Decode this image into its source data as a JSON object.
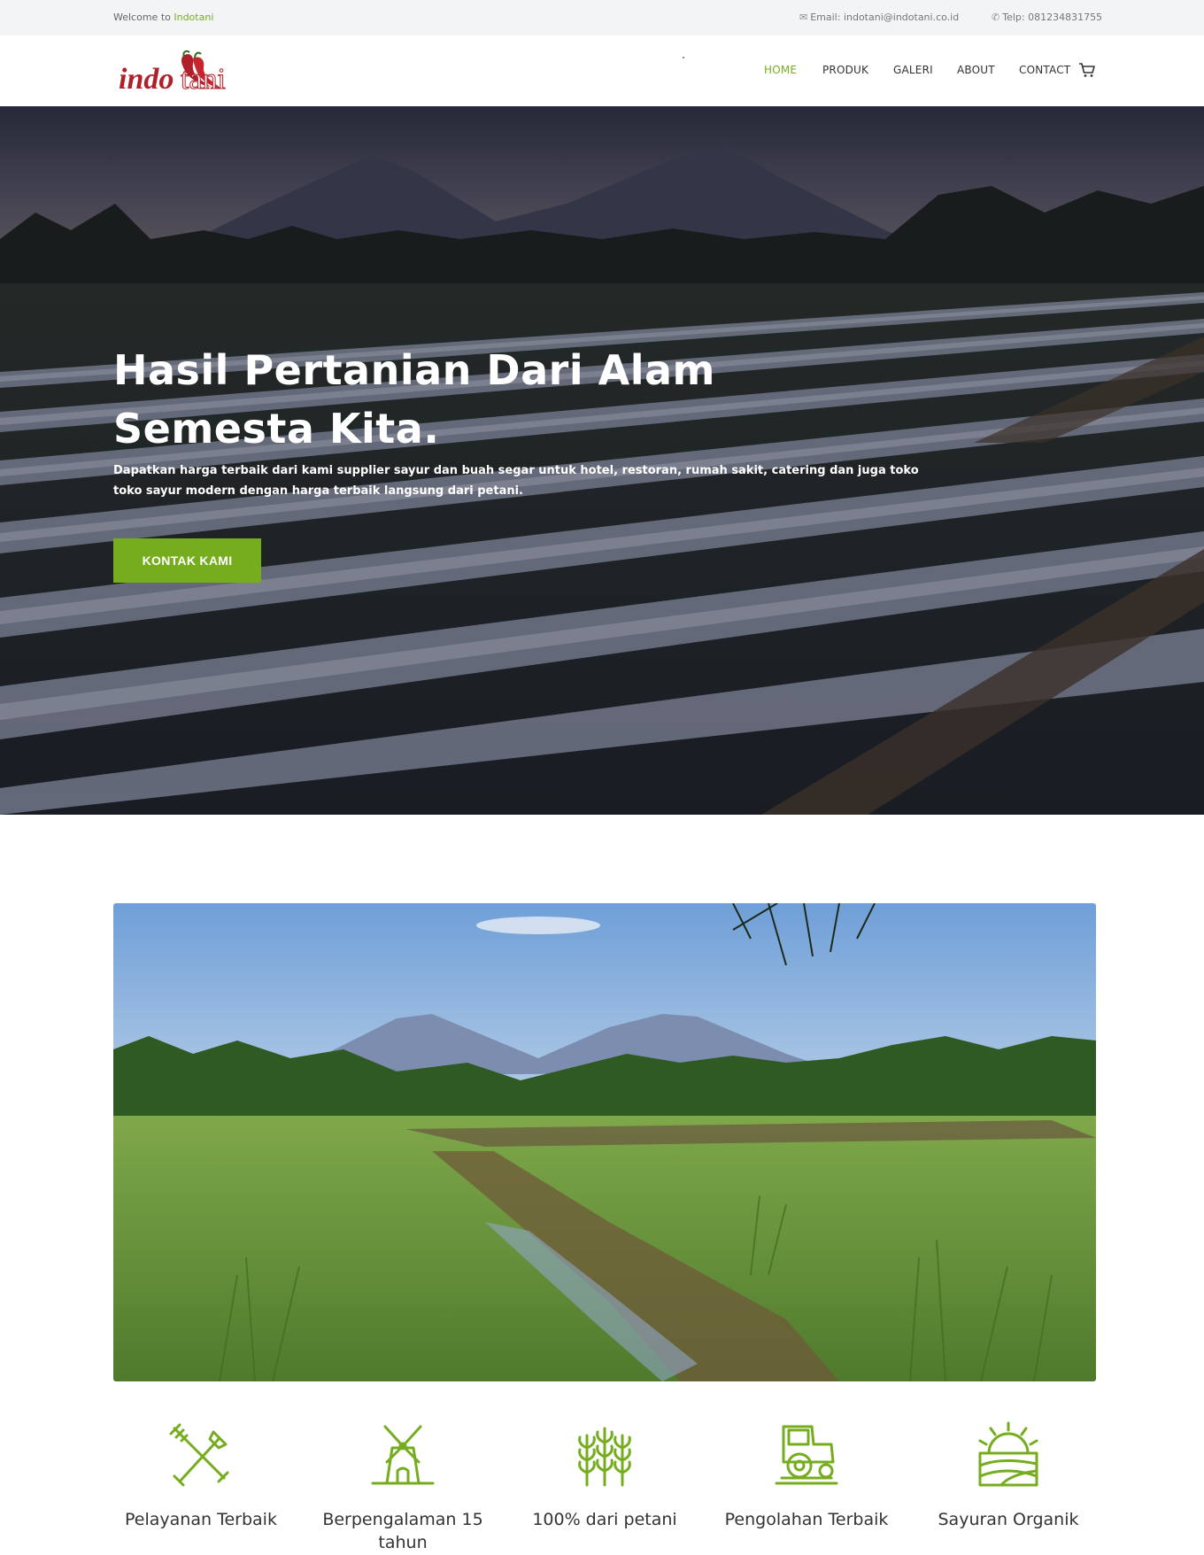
{
  "topbar": {
    "welcome_prefix": "Welcome to",
    "welcome_brand": "Indotani",
    "email": "Email: indotani@indotani.co.id",
    "phone": "Telp: 081234831755"
  },
  "logo": {
    "text_part1": "indo",
    "text_part2": "tani"
  },
  "nav": {
    "home": "HOME",
    "produk": "PRODUK",
    "galeri": "GALERI",
    "about": "ABOUT",
    "contact": "CONTACT"
  },
  "hero": {
    "title": "Hasil Pertanian Dari Alam Semesta Kita.",
    "description": "Dapatkan harga terbaik dari kami supplier sayur dan buah segar untuk hotel, restoran, rumah sakit, catering dan juga toko toko sayur modern dengan harga terbaik langsung dari petani.",
    "button": "KONTAK KAMI"
  },
  "features": [
    {
      "label": "Pelayanan Terbaik",
      "icon": "garden-tools-icon"
    },
    {
      "label": "Berpengalaman 15 tahun",
      "icon": "windmill-icon"
    },
    {
      "label": "100% dari petani",
      "icon": "wheat-icon"
    },
    {
      "label": "Pengolahan Terbaik",
      "icon": "tractor-icon"
    },
    {
      "label": "Sayuran Organik",
      "icon": "sunrise-field-icon"
    }
  ],
  "colors": {
    "accent": "#76ad1f",
    "topbar_bg": "#f3f4f6",
    "logo_red": "#b0202a"
  }
}
